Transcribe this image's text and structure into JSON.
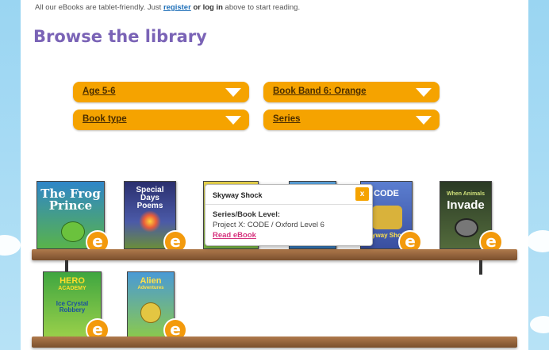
{
  "intro": {
    "text_before": "All our eBooks are tablet-friendly. Just",
    "register": "register",
    "or_login": "or log in",
    "text_after": "above to start reading."
  },
  "title": "Browse the library",
  "filters": [
    {
      "label": "Age 5-6"
    },
    {
      "label": "Book Band 6: Orange"
    },
    {
      "label": "Book type"
    },
    {
      "label": "Series"
    }
  ],
  "ebook_badge": "e",
  "books": [
    {
      "title": "The Frog Prince",
      "lines": [
        "The Frog",
        "Prince"
      ],
      "color": "#2f86c9"
    },
    {
      "title": "Special Days Poems",
      "lines": [
        "Special",
        "Days Poems"
      ],
      "color": "#3a3f8a"
    },
    {
      "title": "CODE Skyway Shock",
      "lines": [
        "CODE",
        "Skyway Shock"
      ],
      "color": "#4a70c2"
    },
    {
      "title": "When Animals Invade",
      "lines": [
        "When Animals",
        "Invade"
      ],
      "color": "#2b3a25"
    },
    {
      "title": "Hero Academy Ice Crystal Robbery",
      "lines": [
        "HERO",
        "ACADEMY",
        "Ice Crystal",
        "Robbery"
      ],
      "color": "#3fa640"
    },
    {
      "title": "Alien Adventures",
      "lines": [
        "Alien",
        "Adventures"
      ],
      "color": "#4a9ad6"
    }
  ],
  "popup": {
    "title": "Skyway Shock",
    "close": "x",
    "series_label": "Series/Book Level:",
    "series_value": "Project X: CODE / Oxford Level 6",
    "link": "Read eBook"
  },
  "colors": {
    "accent": "#f5a300",
    "title": "#7a63b6",
    "link": "#d6337e",
    "sky": "#8fd0ef",
    "shelf": "#9a6840"
  }
}
